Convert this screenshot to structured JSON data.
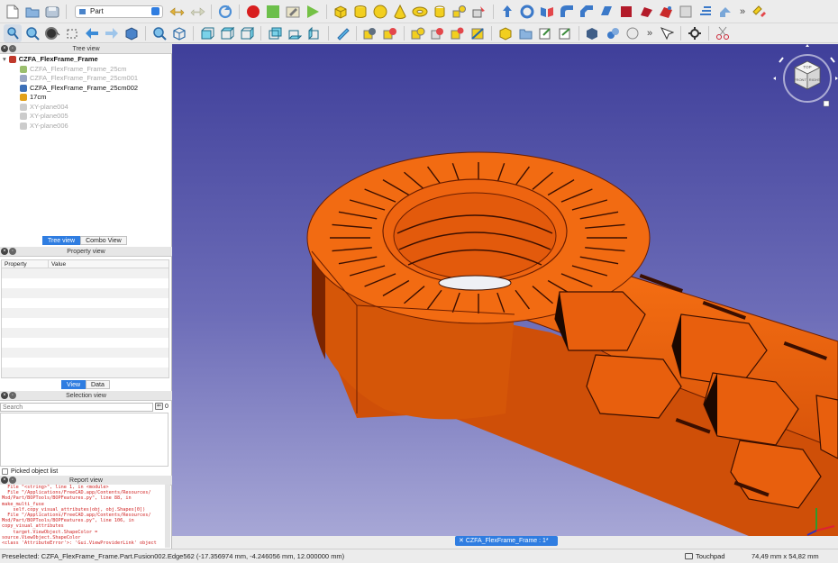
{
  "toolbar": {
    "workbench": "Part",
    "row1_icons": [
      "new-file-icon",
      "open-folder-icon",
      "save-icon",
      "workbench-selector",
      "undo-icon",
      "redo-icon",
      "refresh-icon",
      "record-macro-icon",
      "stop-macro-icon",
      "edit-macro-icon",
      "run-macro-icon",
      "box-icon",
      "cylinder-icon",
      "sphere-icon",
      "cone-icon",
      "torus-icon",
      "primitives-icon",
      "shape-builder-icon",
      "extrude-icon",
      "revolve-icon",
      "mirror-icon",
      "fillet-icon",
      "chamfer-icon",
      "make-face-icon",
      "ruled-surface-icon",
      "loft-icon",
      "sweep-icon",
      "section-icon",
      "cross-sections-icon",
      "offset-icon",
      "thickness-icon"
    ],
    "row2_icons": [
      "select-icon",
      "zoom-fit-icon",
      "draw-style-icon",
      "back-icon",
      "forward-icon",
      "workbench-nav-icon",
      "std-views-icon",
      "isometric-icon",
      "front-view-icon",
      "top-view-icon",
      "right-view-icon",
      "rear-view-icon",
      "bottom-view-icon",
      "left-view-icon",
      "measure-icon",
      "boolean-icon",
      "cut-icon",
      "fuse-icon",
      "common-icon",
      "join-icon",
      "split-icon",
      "compound-icon",
      "check-geometry-icon",
      "defeaturing-icon",
      "attachment-icon",
      "color-per-face-icon",
      "projection-icon",
      "whats-this-icon",
      "std-tools-icon",
      "scissor-icon"
    ]
  },
  "tree": {
    "panel_title": "Tree view",
    "items": [
      {
        "label": "CZFA_FlexFrame_Frame",
        "bold": true,
        "icon_color": "#c0392b",
        "dim": false,
        "indent": 0
      },
      {
        "label": "CZFA_FlexFrame_Frame_25cm",
        "bold": false,
        "icon_color": "#9bbf6e",
        "dim": true,
        "indent": 1
      },
      {
        "label": "CZFA_FlexFrame_Frame_25cm001",
        "bold": false,
        "icon_color": "#9aa6c4",
        "dim": true,
        "indent": 1
      },
      {
        "label": "CZFA_FlexFrame_Frame_25cm002",
        "bold": false,
        "icon_color": "#3c6fb8",
        "dim": false,
        "indent": 1
      },
      {
        "label": "17cm",
        "bold": false,
        "icon_color": "#e2a11b",
        "dim": false,
        "indent": 1
      },
      {
        "label": "XY-plane004",
        "bold": false,
        "icon_color": "#cccccc",
        "dim": true,
        "indent": 1
      },
      {
        "label": "XY-plane005",
        "bold": false,
        "icon_color": "#cccccc",
        "dim": true,
        "indent": 1
      },
      {
        "label": "XY-plane006",
        "bold": false,
        "icon_color": "#cccccc",
        "dim": true,
        "indent": 1
      }
    ],
    "tabs": [
      "Tree view",
      "Combo View"
    ]
  },
  "property": {
    "panel_title": "Property view",
    "columns": [
      "Property",
      "Value"
    ],
    "tabs": [
      "View",
      "Data"
    ]
  },
  "selection": {
    "panel_title": "Selection view",
    "search_placeholder": "Search",
    "count": "0",
    "picked_label": "Picked object list"
  },
  "report": {
    "panel_title": "Report view",
    "lines": [
      "  File \"<string>\", line 1, in <module>",
      "  File \"/Applications/FreeCAD.app/Contents/Resources/",
      "Mod/Part/BOPTools/BOPFeatures.py\", line 88, in",
      "make_multi_fuse",
      "    self.copy_visual_attributes(obj, obj.Shapes[0])",
      "  File \"/Applications/FreeCAD.app/Contents/Resources/",
      "Mod/Part/BOPTools/BOPFeatures.py\", line 106, in",
      "copy_visual_attributes",
      "    target.ViewObject.ShapeColor =",
      "source.ViewObject.ShapeColor",
      "<class 'AttributeError'>: 'Gui.ViewProviderLink' object"
    ]
  },
  "viewport": {
    "doc_tab": "CZFA_FlexFrame_Frame : 1*",
    "model_color": "#f0660e",
    "nav_cube_faces": [
      "TOP",
      "FRONT",
      "RIGHT"
    ]
  },
  "status": {
    "preselected": "Preselected: CZFA_FlexFrame_Frame.Part.Fusion002.Edge562 (-17.356974 mm, -4.246056 mm, 12.000000 mm)",
    "nav_mode": "Touchpad",
    "dimensions": "74,49 mm x 54,82 mm"
  }
}
